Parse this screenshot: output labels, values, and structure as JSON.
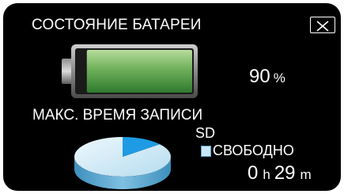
{
  "screen": {
    "title": "СОСТОЯНИЕ БАТАРЕИ",
    "close_icon": "close-x-icon"
  },
  "battery": {
    "icon": "battery-icon",
    "level_fraction": 0.9,
    "percent_value": "90",
    "percent_unit": "%"
  },
  "recording": {
    "label": "МАКС. ВРЕМЯ ЗАПИСИ",
    "media": "SD",
    "legend_label": "СВОБОДНО",
    "free_fraction": 0.86,
    "hours_value": "0",
    "hours_unit": "h",
    "minutes_value": "29",
    "minutes_unit": "m"
  },
  "colors": {
    "background": "#000000",
    "battery_fill_top": "#b6dc9c",
    "battery_fill_bottom": "#2f7a2f",
    "pie_free": "#c9e8f6",
    "pie_used": "#1e9be4"
  }
}
